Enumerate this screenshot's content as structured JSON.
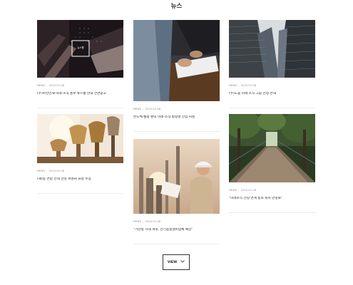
{
  "page": {
    "title": "뉴스"
  },
  "cards": [
    {
      "id": "c1",
      "image": "library-books-photo",
      "overlay_label": "뉴스룸",
      "category": "NEWS",
      "date": "2015.01.08",
      "headline": "(주)아산인재 미래·소식 홍보 뉴스룸 안내 전면광고"
    },
    {
      "id": "c2",
      "image": "handshake-photo",
      "category": "NEWS",
      "date": "2015.01.08",
      "headline": "반도체·통합 편의 미래·소식·방향성 신입 사원"
    },
    {
      "id": "c3",
      "image": "glass-buildings-photo",
      "category": "NEWS",
      "date": "2015.01.08",
      "headline": "(주)도움 미래·소식 그룹 선정 안내"
    },
    {
      "id": "c4",
      "image": "trophies-photo",
      "category": "NEWS",
      "date": "2015.01.08",
      "headline": "(재)종 연합 안내 선정 위원회 표창 수상"
    },
    {
      "id": "c5",
      "image": "engineer-plant-photo",
      "category": "NEWS",
      "date": "2015.01.08",
      "headline": "\"가산동 시대 개막, 전기종합설비업체 예상\""
    },
    {
      "id": "c6",
      "image": "forest-bridge-photo",
      "category": "NEWS",
      "date": "2015.01.08",
      "headline": "\"미래소식 선정 연계 동의 회사 안정화\""
    }
  ],
  "button": {
    "label": "VIEW",
    "icon": "chevron-down-icon"
  }
}
